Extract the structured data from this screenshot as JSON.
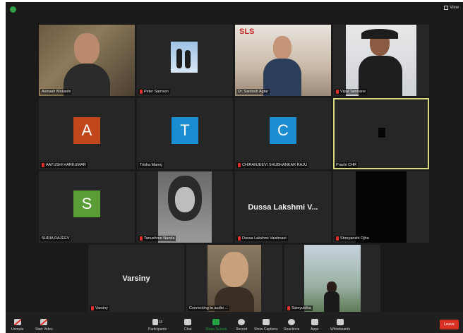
{
  "window": {
    "view_label": "View"
  },
  "participants": [
    {
      "name": "Avinash Mokashi",
      "muted": false
    },
    {
      "name": "Peter Samson",
      "muted": true
    },
    {
      "name": "Dr. Santosh Agtar",
      "muted": false
    },
    {
      "name": "Vipul Tamhane",
      "muted": true
    },
    {
      "name": "AAYUSHI HARKUMAR",
      "muted": true,
      "initial": "A",
      "color": "#c0461c"
    },
    {
      "name": "Trisha Manoj",
      "muted": false,
      "initial": "T",
      "color": "#1b8ed1"
    },
    {
      "name": "CHIRANJEEVI SHUBHANKAR RAJU",
      "muted": true,
      "initial": "C",
      "color": "#1b8ed1"
    },
    {
      "name": "Prachi CHR",
      "muted": false
    },
    {
      "name": "SHRIA RAJEEV",
      "muted": false,
      "initial": "S",
      "color": "#5a9c35"
    },
    {
      "name": "Tanushree Nanda",
      "muted": true
    },
    {
      "name": "Dussa Lakshmi Vaishnavi",
      "muted": true,
      "display": "Dussa Lakshmi V..."
    },
    {
      "name": "Shreyanshi Ojha",
      "muted": true
    },
    {
      "name": "Varsiny",
      "muted": true,
      "display": "Varsiny"
    },
    {
      "name": "Connecting to audio ...",
      "muted": false
    },
    {
      "name": "Samyuktha",
      "muted": true
    }
  ],
  "sls_banner": "SLS",
  "toolbar": {
    "unmute": "Unmute",
    "start_video": "Start Video",
    "participants": "Participants",
    "participants_count": "15",
    "chat": "Chat",
    "share_screen": "Share Screen",
    "record": "Record",
    "show_captions": "Show Captions",
    "reactions": "Reactions",
    "apps": "Apps",
    "whiteboards": "Whiteboards",
    "leave": "Leave"
  },
  "colors": {
    "accent_green": "#25a244",
    "leave_red": "#d93025",
    "active_border": "#d9d982"
  }
}
